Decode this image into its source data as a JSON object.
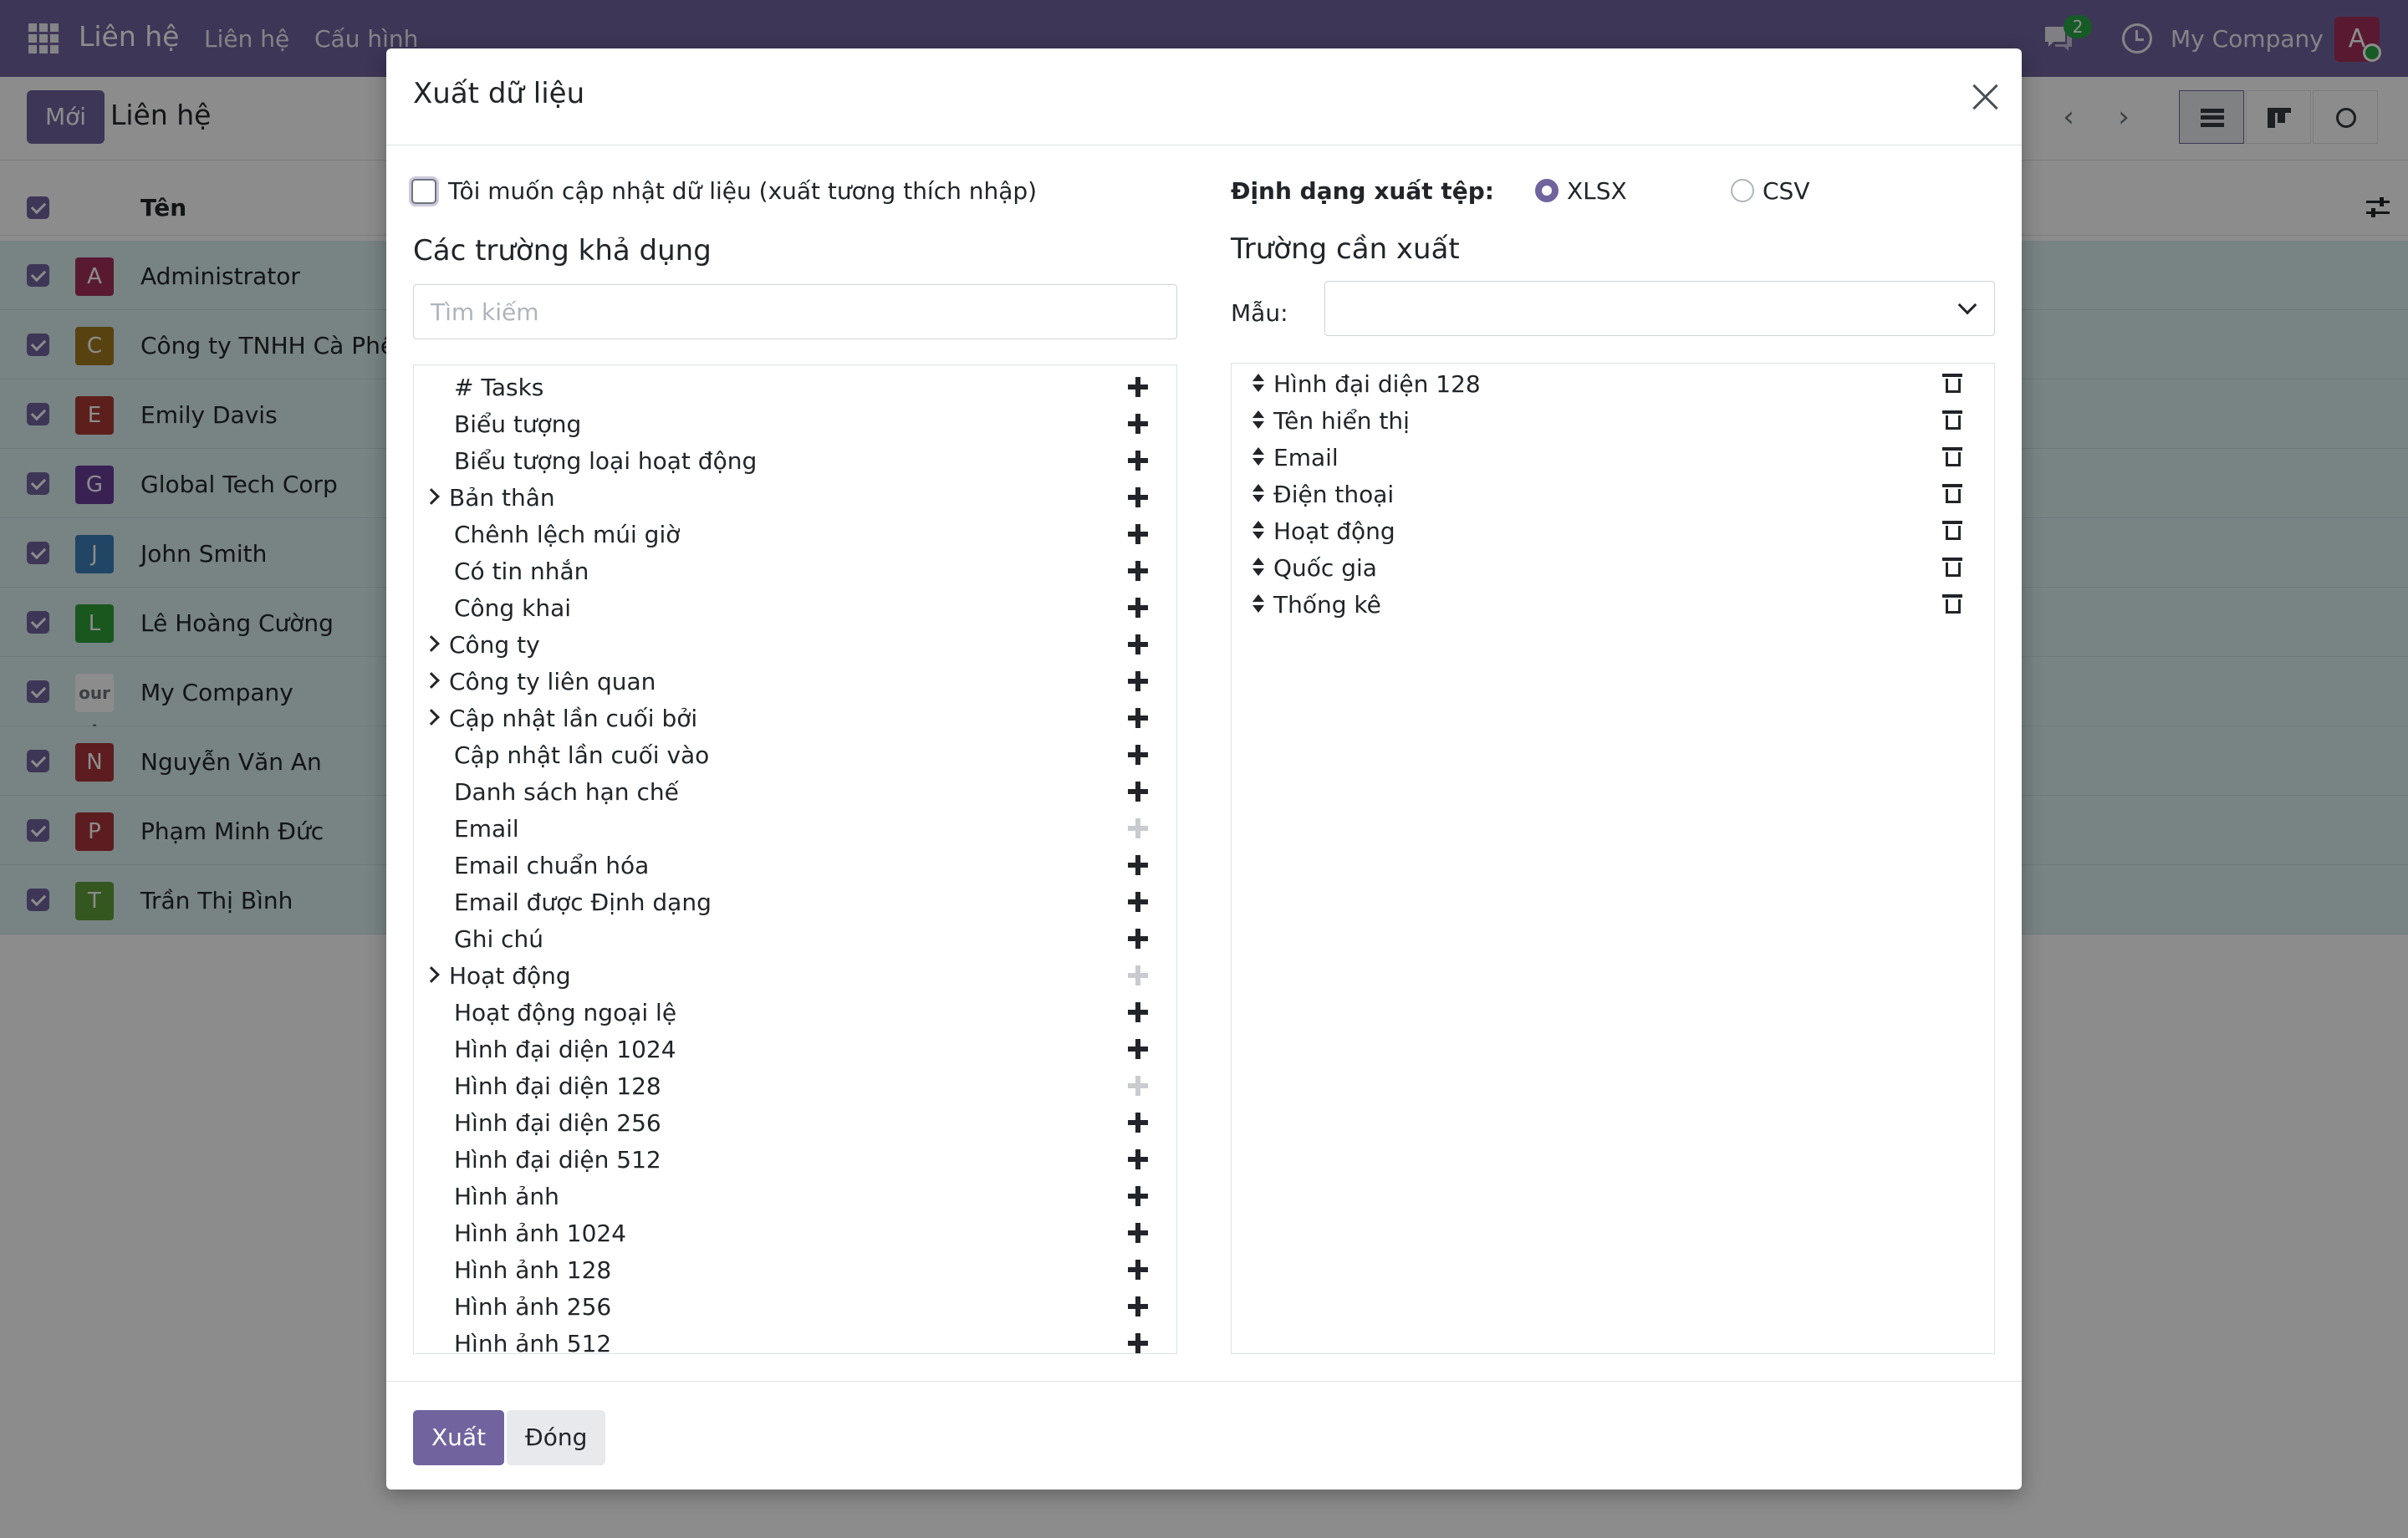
{
  "navbar": {
    "app_name": "Liên hệ",
    "menus": [
      "Liên hệ",
      "Cấu hình"
    ],
    "chat_count": "2",
    "company": "My Company",
    "user_initial": "A"
  },
  "control_panel": {
    "new_button": "Mới",
    "breadcrumb": "Liên hệ",
    "pager_partial": "0"
  },
  "list": {
    "header_name": "Tên",
    "rows": [
      {
        "initial": "A",
        "color": "#a2305a",
        "name": "Administrator"
      },
      {
        "initial": "C",
        "color": "#a07a1e",
        "name": "Công ty TNHH Cà Phê"
      },
      {
        "initial": "E",
        "color": "#a93a33",
        "name": "Emily Davis"
      },
      {
        "initial": "G",
        "color": "#6a3d9a",
        "name": "Global Tech Corp"
      },
      {
        "initial": "J",
        "color": "#3b7fb8",
        "name": "John Smith"
      },
      {
        "initial": "L",
        "color": "#2e9e3a",
        "name": "Lê Hoàng Cường"
      },
      {
        "initial": "our l",
        "color": "#ffffff",
        "name": "My Company"
      },
      {
        "initial": "N",
        "color": "#a9333a",
        "name": "Nguyễn Văn An"
      },
      {
        "initial": "P",
        "color": "#a9333a",
        "name": "Phạm Minh Đức"
      },
      {
        "initial": "T",
        "color": "#5f9e3a",
        "name": "Trần Thị Bình"
      }
    ]
  },
  "modal": {
    "title": "Xuất dữ liệu",
    "import_compat_label": "Tôi muốn cập nhật dữ liệu (xuất tương thích nhập)",
    "format_label": "Định dạng xuất tệp:",
    "format_options": [
      "XLSX",
      "CSV"
    ],
    "format_selected": "XLSX",
    "available_title": "Các trường khả dụng",
    "search_placeholder": "Tìm kiếm",
    "export_title": "Trường cần xuất",
    "template_label": "Mẫu:",
    "available_fields": [
      {
        "label": "# Tasks",
        "expandable": false,
        "added": false
      },
      {
        "label": "Biểu tượng",
        "expandable": false,
        "added": false
      },
      {
        "label": "Biểu tượng loại hoạt động",
        "expandable": false,
        "added": false
      },
      {
        "label": "Bản thân",
        "expandable": true,
        "added": false
      },
      {
        "label": "Chênh lệch múi giờ",
        "expandable": false,
        "added": false
      },
      {
        "label": "Có tin nhắn",
        "expandable": false,
        "added": false
      },
      {
        "label": "Công khai",
        "expandable": false,
        "added": false
      },
      {
        "label": "Công ty",
        "expandable": true,
        "added": false
      },
      {
        "label": "Công ty liên quan",
        "expandable": true,
        "added": false
      },
      {
        "label": "Cập nhật lần cuối bởi",
        "expandable": true,
        "added": false
      },
      {
        "label": "Cập nhật lần cuối vào",
        "expandable": false,
        "added": false
      },
      {
        "label": "Danh sách hạn chế",
        "expandable": false,
        "added": false
      },
      {
        "label": "Email",
        "expandable": false,
        "added": true
      },
      {
        "label": "Email chuẩn hóa",
        "expandable": false,
        "added": false
      },
      {
        "label": "Email được Định dạng",
        "expandable": false,
        "added": false
      },
      {
        "label": "Ghi chú",
        "expandable": false,
        "added": false
      },
      {
        "label": "Hoạt động",
        "expandable": true,
        "added": true
      },
      {
        "label": "Hoạt động ngoại lệ",
        "expandable": false,
        "added": false
      },
      {
        "label": "Hình đại diện 1024",
        "expandable": false,
        "added": false
      },
      {
        "label": "Hình đại diện 128",
        "expandable": false,
        "added": true
      },
      {
        "label": "Hình đại diện 256",
        "expandable": false,
        "added": false
      },
      {
        "label": "Hình đại diện 512",
        "expandable": false,
        "added": false
      },
      {
        "label": "Hình ảnh",
        "expandable": false,
        "added": false
      },
      {
        "label": "Hình ảnh 1024",
        "expandable": false,
        "added": false
      },
      {
        "label": "Hình ảnh 128",
        "expandable": false,
        "added": false
      },
      {
        "label": "Hình ảnh 256",
        "expandable": false,
        "added": false
      },
      {
        "label": "Hình ảnh 512",
        "expandable": false,
        "added": false
      }
    ],
    "export_fields": [
      "Hình đại diện 128",
      "Tên hiển thị",
      "Email",
      "Điện thoại",
      "Hoạt động",
      "Quốc gia",
      "Thống kê"
    ],
    "export_button": "Xuất",
    "close_button": "Đóng"
  }
}
